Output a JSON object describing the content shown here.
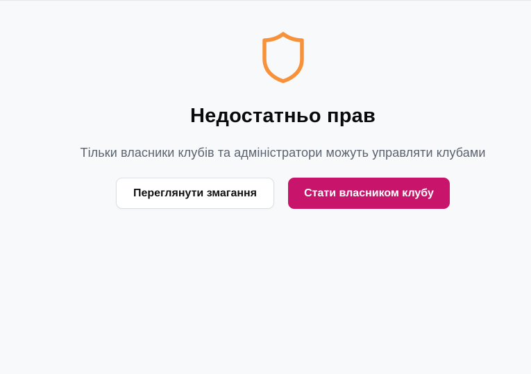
{
  "colors": {
    "accent": "#c8146a",
    "icon": "#f7923b",
    "background": "#f8f9fb"
  },
  "icon": {
    "name": "shield-icon"
  },
  "heading": "Недостатньо прав",
  "message": "Тільки власники клубів та адміністратори можуть управляти клубами",
  "actions": {
    "view_competitions_label": "Переглянути змагання",
    "become_owner_label": "Стати власником клубу"
  }
}
